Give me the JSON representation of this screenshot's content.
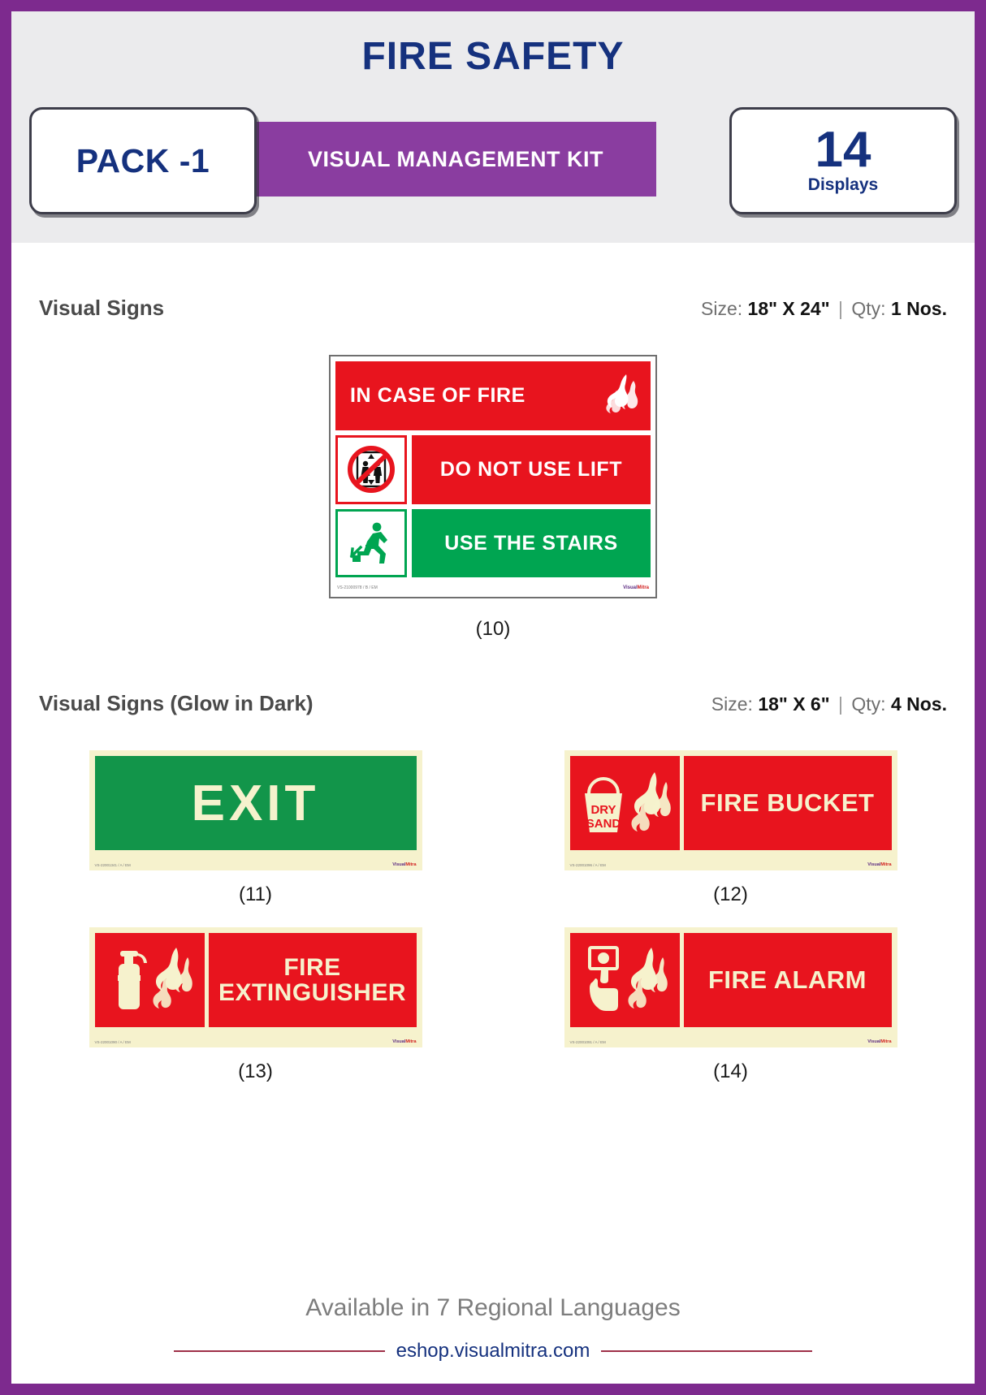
{
  "header": {
    "title": "FIRE SAFETY",
    "pack_label": "PACK -1",
    "kit_label": "VISUAL MANAGEMENT KIT",
    "display_count": "14",
    "display_count_label": "Displays"
  },
  "sections": [
    {
      "title": "Visual Signs",
      "size_prefix": "Size:",
      "size_value": "18\" X 24\"",
      "separator": "|",
      "qty_prefix": "Qty:",
      "qty_value": "1 Nos."
    },
    {
      "title": "Visual Signs (Glow in Dark)",
      "size_prefix": "Size:",
      "size_value": "18\" X 6\"",
      "separator": "|",
      "qty_prefix": "Qty:",
      "qty_value": "4 Nos."
    }
  ],
  "big_sign": {
    "line1": "IN CASE OF FIRE",
    "line2": "DO NOT USE LIFT",
    "line3": "USE THE STAIRS",
    "code": "VS-21000978 / B / EM",
    "brand_a": "Visual",
    "brand_b": "Mitra",
    "caption": "(10)"
  },
  "glow_signs": [
    {
      "label": "EXIT",
      "kind": "exit",
      "code": "VS-22001341 / A / EM",
      "brand_a": "Visual",
      "brand_b": "Mitra",
      "caption": "(11)"
    },
    {
      "label": "FIRE BUCKET",
      "kind": "bucket",
      "icon_text_top": "DRY",
      "icon_text_bottom": "SAND",
      "code": "VS-22001096 / A / EM",
      "brand_a": "Visual",
      "brand_b": "Mitra",
      "caption": "(12)"
    },
    {
      "label_line1": "FIRE",
      "label_line2": "EXTINGUISHER",
      "kind": "extinguisher",
      "code": "VS-22001090 / A / EM",
      "brand_a": "Visual",
      "brand_b": "Mitra",
      "caption": "(13)"
    },
    {
      "label": "FIRE ALARM",
      "kind": "alarm",
      "code": "VS-22001091 / A / EM",
      "brand_a": "Visual",
      "brand_b": "Mitra",
      "caption": "(14)"
    }
  ],
  "footer": {
    "availability": "Available in 7 Regional Languages",
    "url": "eshop.visualmitra.com"
  },
  "colors": {
    "border_purple": "#7d2a8e",
    "kit_bar_purple": "#8a3da0",
    "title_blue": "#15317e",
    "sign_red": "#e8141e",
    "sign_green": "#00a551",
    "glow_cream": "#f6f2cd",
    "glow_green": "#12954a",
    "url_blue": "#15317e",
    "rule_maroon": "#9e3048"
  }
}
